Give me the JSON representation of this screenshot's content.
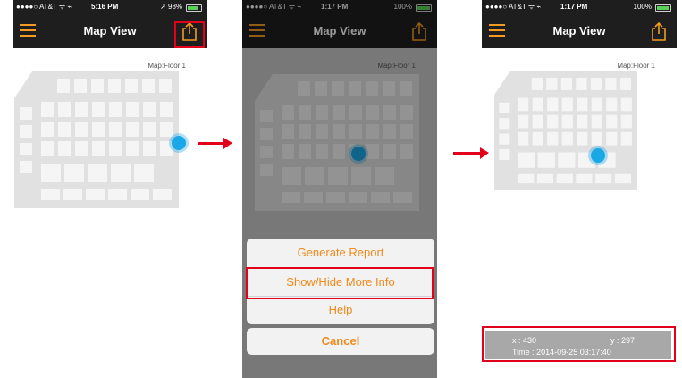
{
  "screens": [
    {
      "status": {
        "carrier": "●●●●○ AT&T ᯤ ⌁",
        "time": "5:16 PM",
        "battery": "➚ 98%"
      },
      "nav_title": "Map View",
      "floor_label": "Map:Floor 1"
    },
    {
      "status": {
        "carrier": "●●●●○ AT&T ᯤ ⌁",
        "time": "1:17 PM",
        "battery": "100%"
      },
      "nav_title": "Map View",
      "floor_label": "Map:Floor 1",
      "action_sheet": {
        "items": [
          "Generate Report",
          "Show/Hide More Info",
          "Help"
        ],
        "cancel": "Cancel"
      }
    },
    {
      "status": {
        "carrier": "●●●●○ AT&T ᯤ ⌁",
        "time": "1:17 PM",
        "battery": "100%"
      },
      "nav_title": "Map View",
      "floor_label": "Map:Floor 1",
      "info": {
        "x": "x : 430",
        "y": "y : 297",
        "time": "Time : 2014-09-25 03:17:40"
      }
    }
  ],
  "colors": {
    "accent": "#f39a21",
    "highlight": "#e3001b",
    "location": "#1aa7e6",
    "nav_bg": "#1e1e1e"
  },
  "icons": {
    "menu": "hamburger-menu-icon",
    "share": "share-icon",
    "location": "location-dot-icon"
  }
}
